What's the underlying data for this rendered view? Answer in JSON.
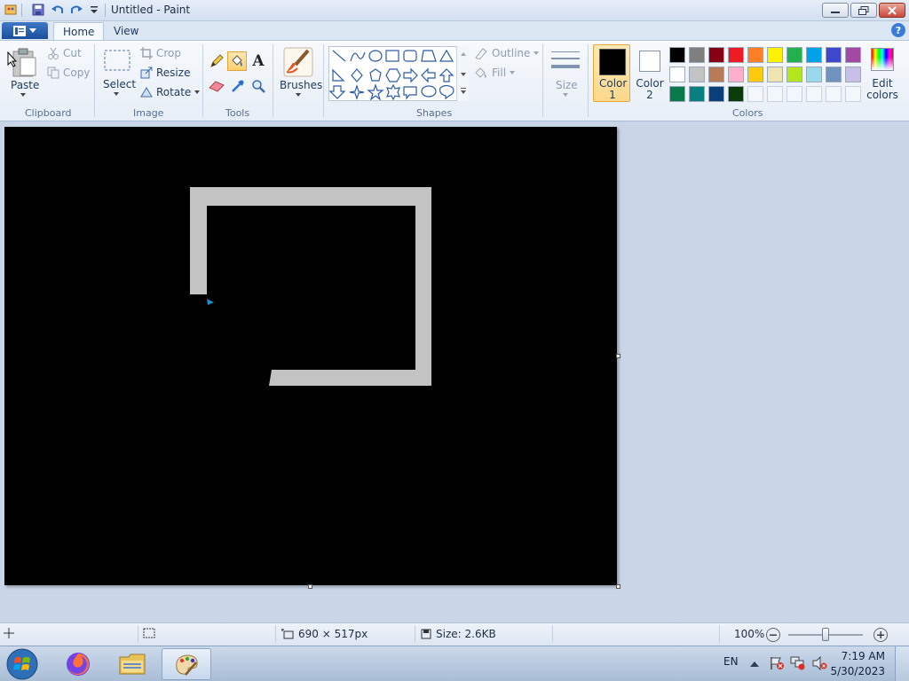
{
  "window": {
    "title": "Untitled - Paint",
    "qat_icons": [
      "paint-app-icon",
      "save-icon",
      "undo-icon",
      "redo-icon",
      "customize-qat-icon"
    ]
  },
  "ribbon": {
    "tabs": [
      "Home",
      "View"
    ],
    "clipboard": {
      "paste": "Paste",
      "cut": "Cut",
      "copy": "Copy",
      "group": "Clipboard"
    },
    "image": {
      "select": "Select",
      "crop": "Crop",
      "resize": "Resize",
      "rotate": "Rotate",
      "group": "Image"
    },
    "tools": {
      "group": "Tools",
      "items": [
        "pencil-icon",
        "fill-icon",
        "text-icon",
        "eraser-icon",
        "color-picker-icon",
        "magnifier-icon"
      ]
    },
    "brushes": {
      "label": "Brushes"
    },
    "shapes": {
      "outline": "Outline",
      "fill": "Fill",
      "group": "Shapes"
    },
    "size": {
      "label": "Size"
    },
    "colors": {
      "color1_label": "Color",
      "color1_num": "1",
      "color2_label": "Color",
      "color2_num": "2",
      "edit_label": "Edit",
      "edit_label2": "colors",
      "group": "Colors",
      "color1": "#000000",
      "color2": "#ffffff",
      "palette_row1": [
        "#000000",
        "#7f7f7f",
        "#880015",
        "#ed1c24",
        "#ff7f27",
        "#fff200",
        "#22b14c",
        "#00a2e8",
        "#3f48cc",
        "#a349a4"
      ],
      "palette_row2": [
        "#ffffff",
        "#c3c3c3",
        "#b97a57",
        "#ffaec9",
        "#ffc90e",
        "#efe4b0",
        "#b5e61d",
        "#99d9ea",
        "#7092be",
        "#c8bfe7"
      ],
      "palette_row3": [
        "#0a7a4a",
        "#088080",
        "#0a3f7a",
        "#0b3b0b"
      ]
    }
  },
  "status": {
    "dimensions": "690 × 517px",
    "size": "Size: 2.6KB",
    "zoom": "100%",
    "zoom_fraction": 0.5
  },
  "taskbar": {
    "apps": [
      "start-button",
      "firefox-icon",
      "file-explorer-icon",
      "paint-icon"
    ],
    "language": "EN",
    "time": "7:19 AM",
    "date": "5/30/2023"
  }
}
